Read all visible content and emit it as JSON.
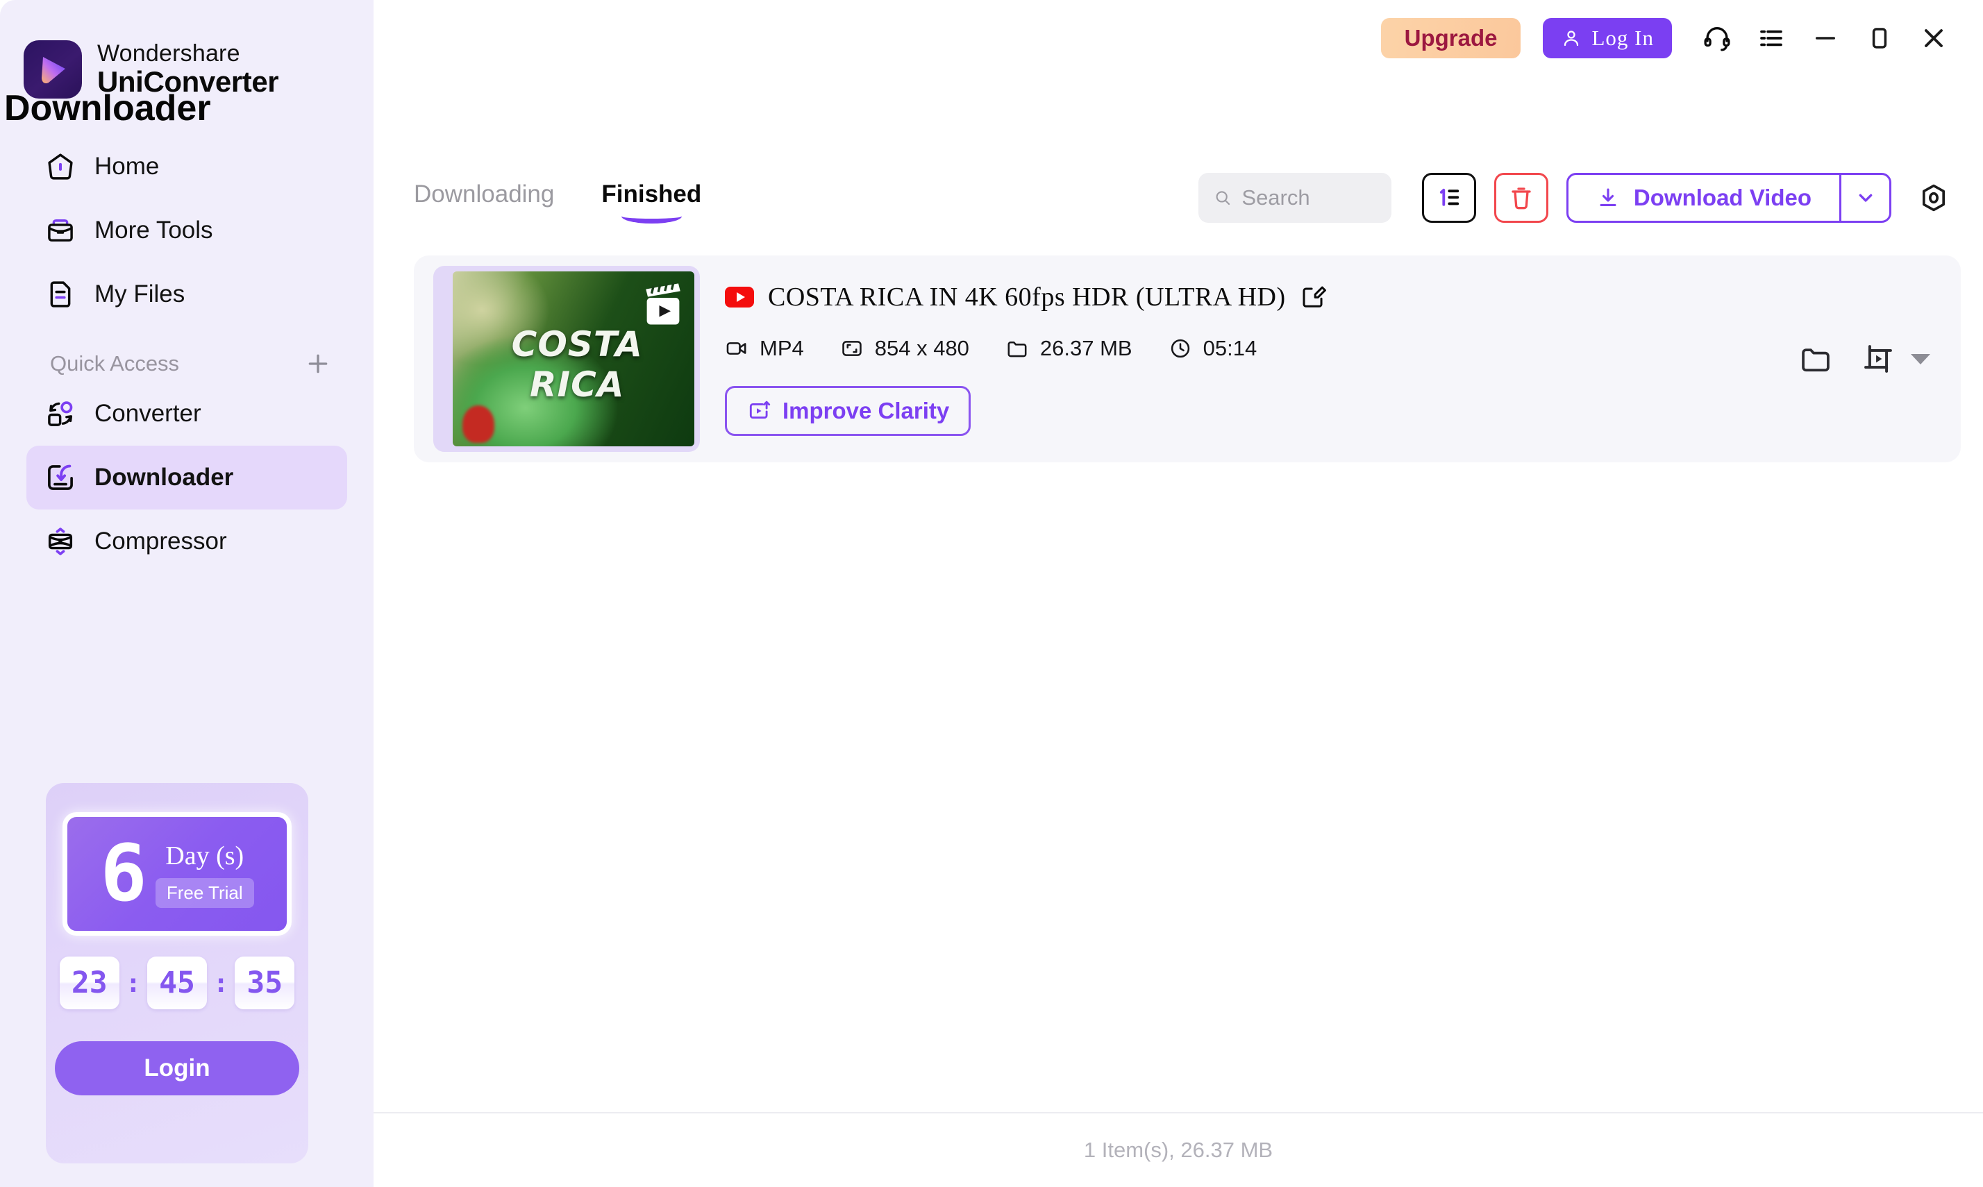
{
  "brand": {
    "line1": "Wondershare",
    "line2": "UniConverter"
  },
  "sidebar": {
    "nav": [
      {
        "label": "Home",
        "icon": "home-icon"
      },
      {
        "label": "More Tools",
        "icon": "toolbox-icon"
      },
      {
        "label": "My Files",
        "icon": "file-icon"
      }
    ],
    "quick_access_label": "Quick Access",
    "add_label": "+",
    "quick": [
      {
        "label": "Converter",
        "icon": "converter-icon",
        "active": false
      },
      {
        "label": "Downloader",
        "icon": "downloader-icon",
        "active": true
      },
      {
        "label": "Compressor",
        "icon": "compressor-icon",
        "active": false
      }
    ],
    "promo": {
      "days": "6",
      "days_label": "Day (s)",
      "badge": "Free Trial",
      "hours": "23",
      "minutes": "45",
      "seconds": "35",
      "separator": ":",
      "login_label": "Login"
    }
  },
  "titlebar": {
    "upgrade_label": "Upgrade",
    "login_label": "Log In",
    "support_icon": "headset-icon",
    "menu_icon": "list-menu-icon",
    "minimize_icon": "minimize-icon",
    "maximize_icon": "maximize-icon",
    "close_icon": "close-icon"
  },
  "page": {
    "title": "Downloader",
    "tabs": [
      {
        "label": "Downloading",
        "active": false
      },
      {
        "label": "Finished",
        "active": true
      }
    ]
  },
  "toolbar": {
    "search_placeholder": "Search",
    "search_value": "",
    "sort_icon": "sort-number-icon",
    "delete_icon": "trash-icon",
    "download_label": "Download Video",
    "download_caret_icon": "chevron-down-icon",
    "settings_icon": "gear-icon"
  },
  "items": [
    {
      "source": "youtube",
      "title": "COSTA RICA IN 4K 60fps HDR (ULTRA HD)",
      "thumbnail_text": "COSTA RICA",
      "format": "MP4",
      "resolution": "854 x 480",
      "size": "26.37 MB",
      "duration": "05:14",
      "action_label": "Improve Clarity",
      "edit_icon": "edit-icon",
      "folder_icon": "folder-icon",
      "convert_icon": "convert-video-icon",
      "more_icon": "caret-down-icon"
    }
  ],
  "footer": {
    "status": "1 Item(s), 26.37 MB"
  },
  "colors": {
    "accent": "#7c3ff2",
    "sidebar_bg": "#f1eefb",
    "active_nav_bg": "#e5d8fb",
    "upgrade_bg": "#fbc89c",
    "upgrade_text": "#9c1840",
    "danger": "#f2474d",
    "card_bg": "#f6f6fa"
  }
}
